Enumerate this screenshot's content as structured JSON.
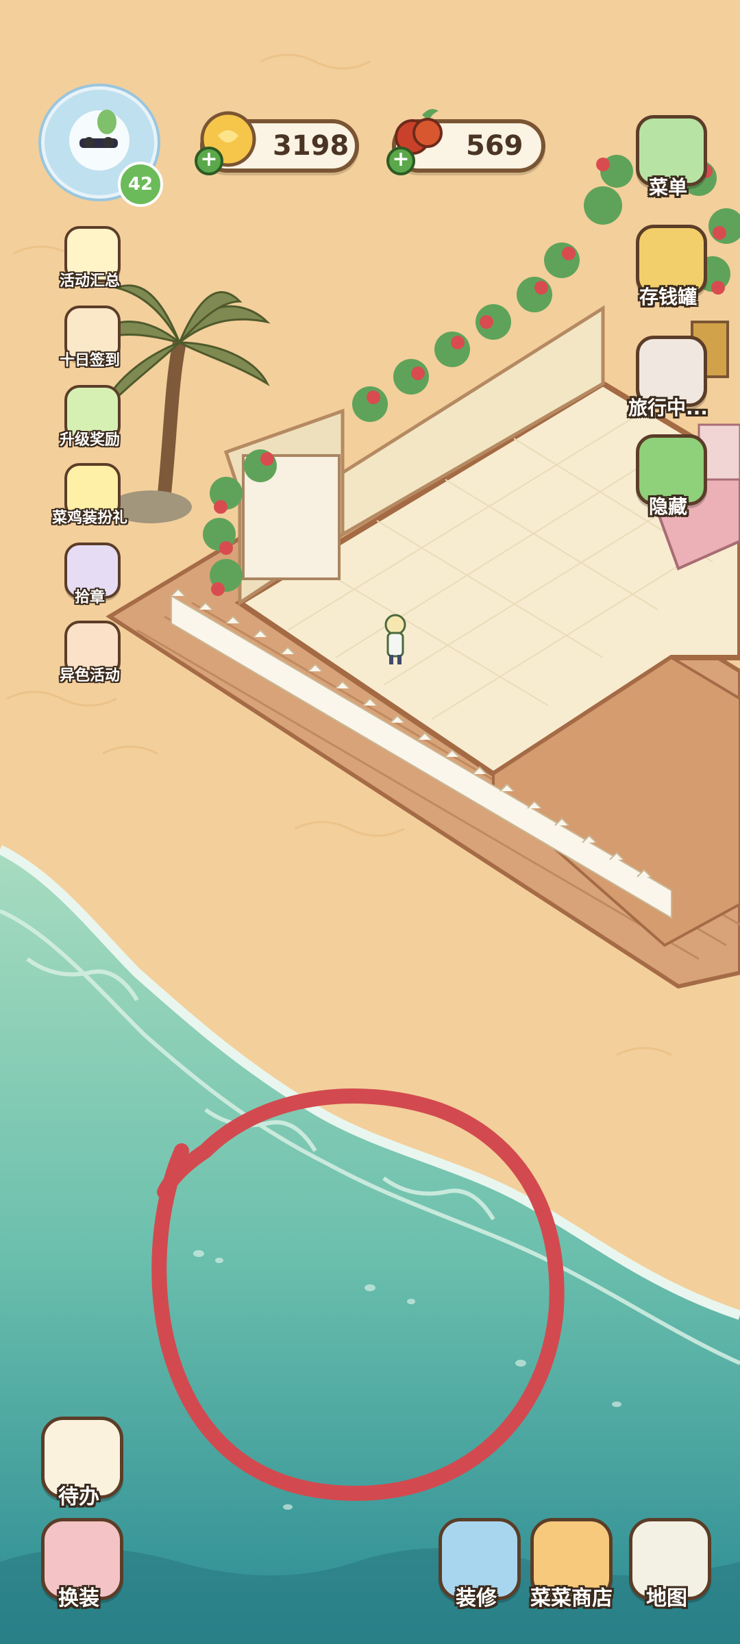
{
  "hud": {
    "level": "42",
    "coins": "3198",
    "food": "569"
  },
  "left_menu": {
    "events_summary": "活动汇总",
    "ten_day_checkin": "十日签到",
    "level_rewards": "升级奖励",
    "chick_outfit_gift": "菜鸡装扮礼",
    "collect_badges": "拾章",
    "variant_event": "异色活动"
  },
  "right_menu": {
    "menu": "菜单",
    "piggy_bank": "存钱罐",
    "traveling": "旅行中...",
    "hide": "隐藏"
  },
  "bottom_menu": {
    "todo": "待办",
    "dress_up": "换装",
    "decorate": "装修",
    "veggie_shop": "菜菜商店",
    "map": "地图"
  },
  "colors": {
    "sand": "#f3cf9b",
    "sea_shallow": "#8fd0b4",
    "sea_deep": "#2f8c92",
    "annotation_circle": "#d24a4f",
    "hud_border": "#7a5533"
  }
}
